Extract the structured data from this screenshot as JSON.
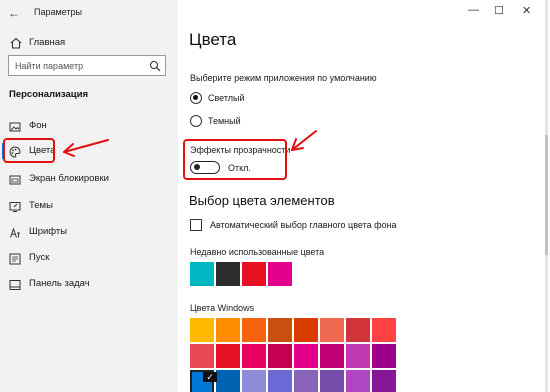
{
  "window": {
    "title": "Параметры",
    "controls": {
      "minimize": "—",
      "maximize": "☐",
      "close": "✕"
    }
  },
  "sidebar": {
    "home_label": "Главная",
    "search_placeholder": "Найти параметр",
    "section_title": "Персонализация",
    "items": [
      {
        "label": "Фон",
        "icon": "image-icon"
      },
      {
        "label": "Цвета",
        "icon": "palette-icon",
        "active": true
      },
      {
        "label": "Экран блокировки",
        "icon": "lock-screen-icon"
      },
      {
        "label": "Темы",
        "icon": "brush-icon"
      },
      {
        "label": "Шрифты",
        "icon": "font-icon"
      },
      {
        "label": "Пуск",
        "icon": "start-icon"
      },
      {
        "label": "Панель задач",
        "icon": "taskbar-icon"
      }
    ]
  },
  "main": {
    "title": "Цвета",
    "app_mode_label": "Выберите режим приложения по умолчанию",
    "mode_options": [
      {
        "label": "Светлый",
        "selected": true
      },
      {
        "label": "Темный",
        "selected": false
      }
    ],
    "transparency_label": "Эффекты прозрачности",
    "transparency_state": "Откл.",
    "element_colors_title": "Выбор цвета элементов",
    "auto_accent_label": "Автоматический выбор главного цвета фона",
    "recent_colors_label": "Недавно использованные цвета",
    "recent_colors": [
      "#00b7c3",
      "#2d2d2d",
      "#e81123",
      "#e3008c"
    ],
    "windows_colors_label": "Цвета Windows",
    "windows_colors": [
      [
        "#ffb900",
        "#ff8c00",
        "#f7630c",
        "#ca5010",
        "#da3b01",
        "#ef6950",
        "#d13438",
        "#ff4343"
      ],
      [
        "#e74856",
        "#e81123",
        "#ea005e",
        "#c30052",
        "#e3008c",
        "#bf0077",
        "#c239b3",
        "#9a0089"
      ],
      [
        "#0078d7",
        "#0063b1",
        "#8e8cd8",
        "#6b69d6",
        "#8764b8",
        "#744da9",
        "#b146c2",
        "#881798"
      ]
    ],
    "selected_color": "#0078d7"
  },
  "colors": {
    "accent": "#0078d7",
    "annotation": "#e01010",
    "sidebar_bg": "#f2f2f2"
  }
}
